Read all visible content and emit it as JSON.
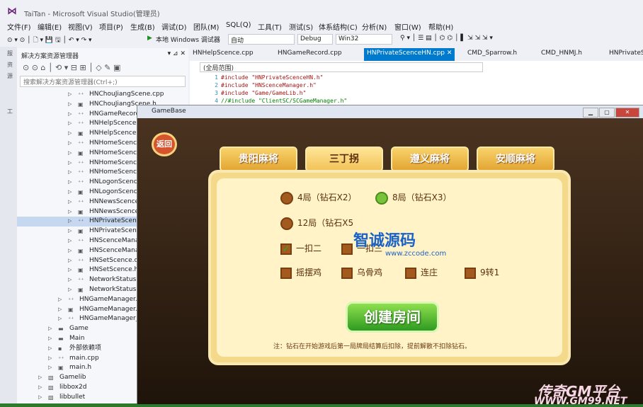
{
  "window": {
    "title": "TaiTan - Microsoft Visual Studio(管理员)"
  },
  "menu": [
    "文件(F)",
    "编辑(E)",
    "视图(V)",
    "项目(P)",
    "生成(B)",
    "调试(D)",
    "团队(M)",
    "SQL(Q)",
    "工具(T)",
    "测试(S)",
    "体系结构(C)",
    "分析(N)",
    "窗口(W)",
    "帮助(H)"
  ],
  "toolbar": {
    "run": "本地 Windows 调试器",
    "auto": "自动",
    "config": "Debug",
    "platform": "Win32"
  },
  "solution_explorer": {
    "title": "解决方案资源管理器",
    "search_placeholder": "搜索解决方案资源管理器(Ctrl+;)",
    "items": [
      {
        "label": "HNChouJiangScene.cpp",
        "indent": 78,
        "arrow": "▷",
        "icon": "⁺⁺"
      },
      {
        "label": "HNChouJiangScene.h",
        "indent": 78,
        "arrow": "▷",
        "icon": "▣"
      },
      {
        "label": "HNGameRecord.cpp",
        "indent": 78,
        "arrow": "▷",
        "icon": "⁺⁺"
      },
      {
        "label": "HNHelpScence.cpp",
        "indent": 78,
        "arrow": "▷",
        "icon": "⁺⁺"
      },
      {
        "label": "HNHelpScence.h",
        "indent": 78,
        "arrow": "▷",
        "icon": "▣"
      },
      {
        "label": "HNHomeScence.cpp",
        "indent": 78,
        "arrow": "▷",
        "icon": "⁺⁺"
      },
      {
        "label": "HNHomeScence.h",
        "indent": 78,
        "arrow": "▷",
        "icon": "▣"
      },
      {
        "label": "HNHomeScence_Butt",
        "indent": 78,
        "arrow": "▷",
        "icon": "⁺⁺"
      },
      {
        "label": "HNHomeScence_Sink",
        "indent": 78,
        "arrow": "▷",
        "icon": "⁺⁺"
      },
      {
        "label": "HNLogonScence.cpp",
        "indent": 78,
        "arrow": "▷",
        "icon": "⁺⁺"
      },
      {
        "label": "HNLogonScence.h",
        "indent": 78,
        "arrow": "▷",
        "icon": "▣"
      },
      {
        "label": "HNNewsScence.cpp",
        "indent": 78,
        "arrow": "▷",
        "icon": "⁺⁺"
      },
      {
        "label": "HNNewsScence.h",
        "indent": 78,
        "arrow": "▷",
        "icon": "▣"
      },
      {
        "label": "HNPrivateScenceHN.",
        "indent": 78,
        "arrow": "▷",
        "icon": "⁺⁺",
        "selected": true
      },
      {
        "label": "HNPrivateScenceHN.l",
        "indent": 78,
        "arrow": "▷",
        "icon": "▣"
      },
      {
        "label": "HNScenceManager.c",
        "indent": 78,
        "arrow": "▷",
        "icon": "⁺⁺"
      },
      {
        "label": "HNScenceManager.h",
        "indent": 78,
        "arrow": "▷",
        "icon": "▣"
      },
      {
        "label": "HNSetScence.cpp",
        "indent": 78,
        "arrow": "▷",
        "icon": "⁺⁺"
      },
      {
        "label": "HNSetScence.h",
        "indent": 78,
        "arrow": "▷",
        "icon": "▣"
      },
      {
        "label": "NetworkStatus.cpp",
        "indent": 78,
        "arrow": "▷",
        "icon": "⁺⁺"
      },
      {
        "label": "NetworkStatus.h",
        "indent": 78,
        "arrow": "▷",
        "icon": "▣"
      },
      {
        "label": "HNGameManager.cpp",
        "indent": 64,
        "arrow": "▷",
        "icon": "⁺⁺"
      },
      {
        "label": "HNGameManager.h",
        "indent": 64,
        "arrow": "▷",
        "icon": "▣"
      },
      {
        "label": "HNGameManager_Game",
        "indent": 64,
        "arrow": "▷",
        "icon": "⁺⁺"
      },
      {
        "label": "Game",
        "indent": 50,
        "arrow": "▷",
        "icon": "▬"
      },
      {
        "label": "Main",
        "indent": 50,
        "arrow": "▷",
        "icon": "▬"
      },
      {
        "label": "外部依赖项",
        "indent": 50,
        "arrow": "▷",
        "icon": "▪"
      },
      {
        "label": "main.cpp",
        "indent": 50,
        "arrow": "▷",
        "icon": "⁺⁺"
      },
      {
        "label": "main.h",
        "indent": 50,
        "arrow": "▷",
        "icon": "▣"
      },
      {
        "label": "Gamelib",
        "indent": 36,
        "arrow": "▷",
        "icon": "▧"
      },
      {
        "label": "libbox2d",
        "indent": 36,
        "arrow": "▷",
        "icon": "▧"
      },
      {
        "label": "libbullet",
        "indent": 36,
        "arrow": "▷",
        "icon": "▧"
      }
    ]
  },
  "editor": {
    "tabs": [
      "HNHelpScence.cpp",
      "HNGameRecord.cpp",
      "HNPrivateScenceHN.cpp",
      "CMD_Sparrow.h",
      "CMD_HNMJ.h",
      "HNPrivateS"
    ],
    "active_tab": "HNPrivateScenceHN.cpp",
    "scope": "(全局范围)",
    "lines": [
      {
        "n": "1",
        "text": "#include \"HNPrivateScenceHN.h\""
      },
      {
        "n": "2",
        "text": "#include \"HNScenceManager.h\""
      },
      {
        "n": "3",
        "text": "#include \"Game/GameLib.h\""
      },
      {
        "n": "4",
        "text": "//#include \"ClientSC/SCGameManager.h\""
      }
    ]
  },
  "game_window": {
    "title": "GameBase",
    "back": "返回",
    "tabs": [
      "贵阳麻将",
      "三丁拐",
      "遵义麻将",
      "安顺麻将"
    ],
    "rounds": [
      {
        "label": "4局（钻石X2）",
        "on": false
      },
      {
        "label": "8局（钻石X3）",
        "on": true
      },
      {
        "label": "12局（钻石X5",
        "on": false
      }
    ],
    "checks": [
      {
        "label": "一扣二",
        "on": true
      },
      {
        "label": "一扣三",
        "on": false
      }
    ],
    "options": [
      "摇摆鸡",
      "乌骨鸡",
      "连庄",
      "9转1"
    ],
    "create": "创建房间",
    "note": "注：钻石在开始游戏后第一局牌局结算后扣除，提前解散不扣除钻石。",
    "watermark1": "智诚源码",
    "watermark2": "www.zccode.com",
    "watermark3": "传奇GM平台",
    "watermark4": "WWW.GM99.NET"
  }
}
